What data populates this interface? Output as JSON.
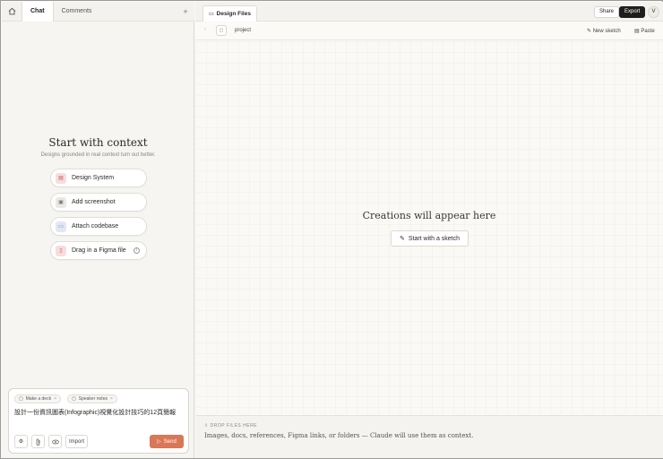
{
  "left_panel": {
    "tabs": [
      {
        "label": "Chat",
        "active": true
      },
      {
        "label": "Comments",
        "active": false
      }
    ],
    "context": {
      "title": "Start with context",
      "subtitle": "Designs grounded in real context turn out better.",
      "buttons": [
        {
          "label": "Design System",
          "icon": "design-system-icon",
          "color": "#f6dede"
        },
        {
          "label": "Add screenshot",
          "icon": "image-icon",
          "color": "#ece9e2"
        },
        {
          "label": "Attach codebase",
          "icon": "folder-icon",
          "color": "#e1e8f3"
        },
        {
          "label": "Drag in a Figma file",
          "icon": "figma-icon",
          "color": "#f6dede"
        }
      ]
    },
    "composer": {
      "chips": [
        {
          "label": "Make a deck"
        },
        {
          "label": "Speaker notes"
        }
      ],
      "text": "設計一份資訊圖表(Infographic)視覺化設計技巧的12頁簡報",
      "import_label": "Import",
      "send_label": "Send",
      "accent": "#d97757"
    }
  },
  "right_panel": {
    "tab_label": "Design Files",
    "share_label": "Share",
    "export_label": "Export",
    "avatar_initial": "V",
    "toolbar": {
      "project_label": "project",
      "new_sketch_label": "New sketch",
      "paste_label": "Paste"
    },
    "empty_state": {
      "title": "Creations will appear here",
      "sketch_label": "Start with a sketch"
    },
    "dropzone": {
      "title": "DROP FILES HERE",
      "description": "Images, docs, references, Figma links, or folders — Claude will use them as context."
    }
  }
}
